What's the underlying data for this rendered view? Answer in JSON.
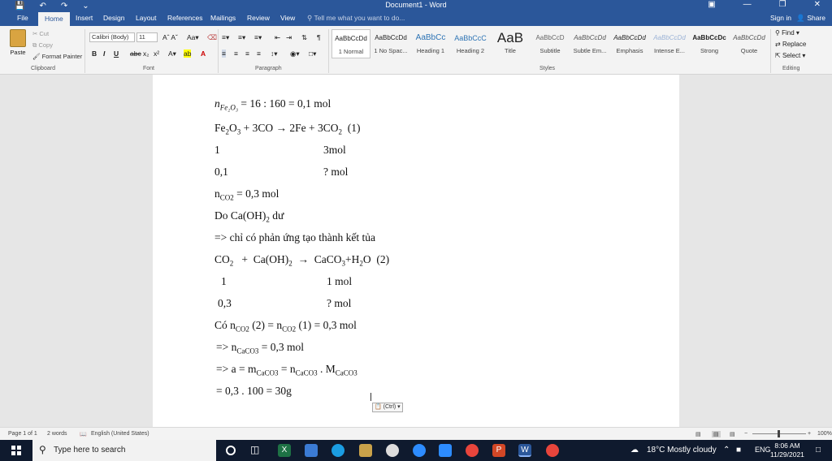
{
  "titlebar": {
    "title": "Document1  -  Word"
  },
  "tabs": [
    {
      "label": "File"
    },
    {
      "label": "Home"
    },
    {
      "label": "Insert"
    },
    {
      "label": "Design"
    },
    {
      "label": "Layout"
    },
    {
      "label": "References"
    },
    {
      "label": "Mailings"
    },
    {
      "label": "Review"
    },
    {
      "label": "View"
    }
  ],
  "tell_me": "Tell me what you want to do...",
  "account": {
    "signin": "Sign in",
    "share": "Share"
  },
  "clipboard": {
    "paste": "Paste",
    "cut": "Cut",
    "copy": "Copy",
    "format_painter": "Format Painter",
    "label": "Clipboard"
  },
  "font": {
    "name": "Calibri (Body)",
    "size": "11",
    "label": "Font"
  },
  "paragraph": {
    "label": "Paragraph"
  },
  "styles": {
    "label": "Styles",
    "items": [
      {
        "preview": "AaBbCcDd",
        "name": "1 Normal"
      },
      {
        "preview": "AaBbCcDd",
        "name": "1 No Spac..."
      },
      {
        "preview": "AaBbCc",
        "name": "Heading 1"
      },
      {
        "preview": "AaBbCcC",
        "name": "Heading 2"
      },
      {
        "preview": "AaB",
        "name": "Title"
      },
      {
        "preview": "AaBbCcD",
        "name": "Subtitle"
      },
      {
        "preview": "AaBbCcDd",
        "name": "Subtle Em..."
      },
      {
        "preview": "AaBbCcDd",
        "name": "Emphasis"
      },
      {
        "preview": "AaBbCcDd",
        "name": "Intense E..."
      },
      {
        "preview": "AaBbCcDc",
        "name": "Strong"
      },
      {
        "preview": "AaBbCcDd",
        "name": "Quote"
      }
    ]
  },
  "editing": {
    "find": "Find",
    "replace": "Replace",
    "select": "Select",
    "label": "Editing"
  },
  "document": {
    "l1": {
      "a": "n",
      "b": "Fe₂O₃",
      "c": " = 16 : 160 = 0,1 mol"
    },
    "l2": {
      "a": "Fe",
      "b": "2",
      "c": "O",
      "d": "3",
      "e": " + 3CO → 2Fe + 3CO",
      "f": "2",
      "g": "  (1)"
    },
    "l3": {
      "a": "1",
      "b": "3mol"
    },
    "l4": {
      "a": "0,1",
      "b": "? mol"
    },
    "l5": {
      "a": "n",
      "b": "CO2",
      "c": " = 0,3 mol"
    },
    "l6": {
      "a": "Do Ca(OH)",
      "b": "2",
      "c": " dư"
    },
    "l7": "=> chỉ có phản ứng tạo thành kết tủa",
    "l8": {
      "a": "CO",
      "b": "2",
      "c": "   +  Ca(OH)",
      "d": "2",
      "e": "  →  CaCO",
      "f": "3",
      "g": "+H",
      "h": "2",
      "i": "O  (2)"
    },
    "l9": {
      "a": "1",
      "b": "1 mol"
    },
    "l10": {
      "a": "0,3",
      "b": "? mol"
    },
    "l11": {
      "a": "Có n",
      "b": "CO2",
      "c": " (2) = n",
      "d": "CO2",
      "e": " (1) = 0,3 mol"
    },
    "l12": {
      "a": "=> n",
      "b": "CaCO3",
      "c": " = 0,3 mol"
    },
    "l13": {
      "a": "=> a = m",
      "b": "CaCO3",
      "c": " = n",
      "d": "CaCO3",
      "e": " . M",
      "f": "CaCO3"
    },
    "l14": "= 0,3 . 100 = 30g",
    "paste_options": "(Ctrl) ▾"
  },
  "statusbar": {
    "page": "Page 1 of 1",
    "words": "2 words",
    "language": "English (United States)",
    "zoom": "100%"
  },
  "taskbar": {
    "search_placeholder": "Type here to search",
    "weather": "18°C  Mostly cloudy",
    "lang": "ENG",
    "time": "8:06 AM",
    "date": "11/29/2021"
  },
  "colors": {
    "word_blue": "#2b579a",
    "taskbar": "#0f1a2e"
  }
}
